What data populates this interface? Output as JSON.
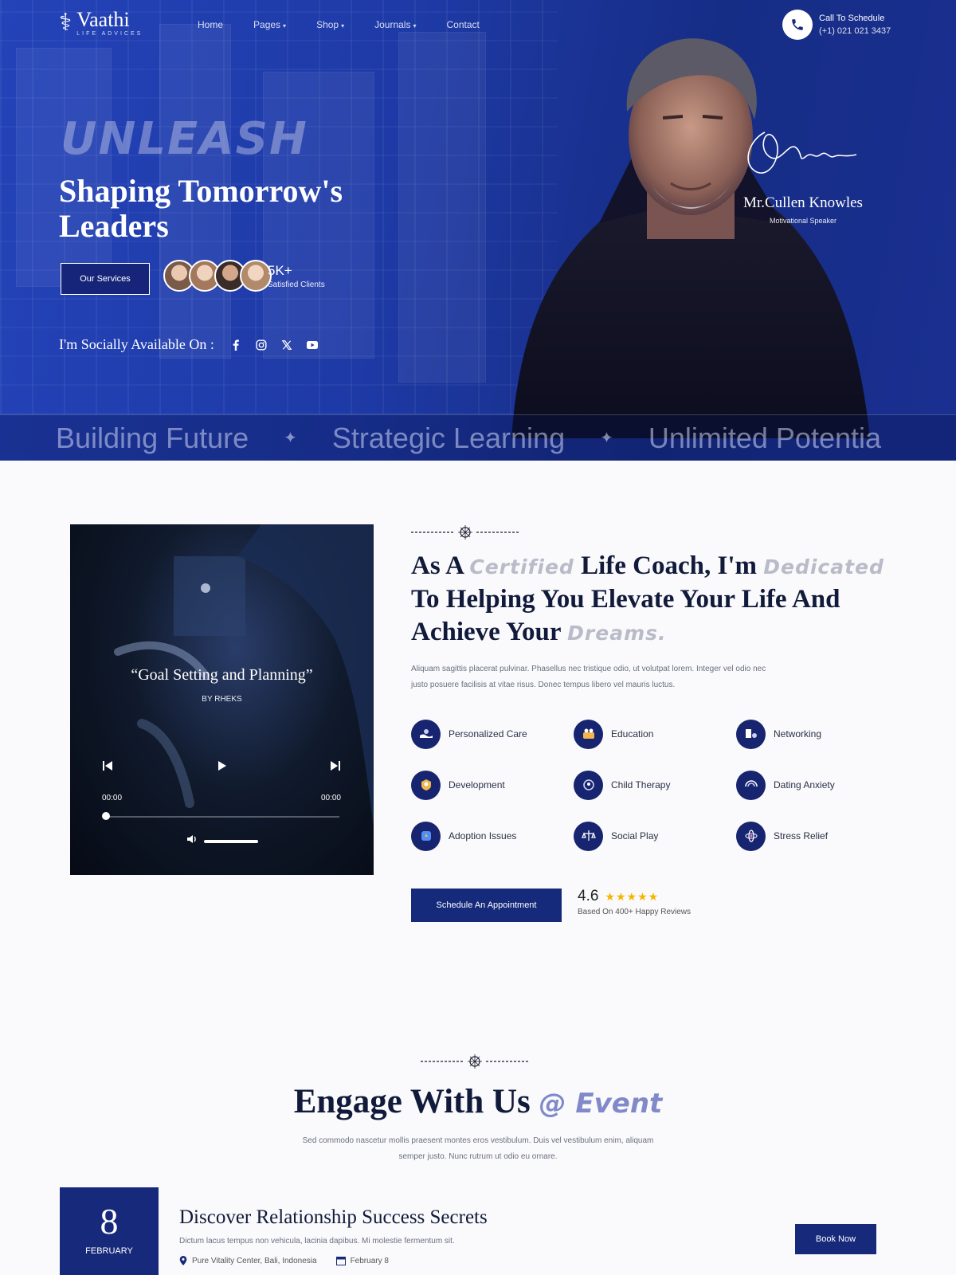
{
  "brand": {
    "name": "Vaathi",
    "tagline": "LIFE ADVICES"
  },
  "nav": [
    {
      "label": "Home",
      "dropdown": false
    },
    {
      "label": "Pages",
      "dropdown": true
    },
    {
      "label": "Shop",
      "dropdown": true
    },
    {
      "label": "Journals",
      "dropdown": true
    },
    {
      "label": "Contact",
      "dropdown": false
    }
  ],
  "call": {
    "title": "Call To Schedule",
    "phone": "(+1) 021 021 3437"
  },
  "hero": {
    "overlay_word": "UNLEASH",
    "headline": "Shaping Tomorrow's Leaders",
    "button": "Our Services",
    "clients_count": "5K+",
    "clients_label": "Satisfied Clients",
    "social_label": "I'm Socially Available On :",
    "social_icons": [
      "facebook-icon",
      "instagram-icon",
      "x-icon",
      "youtube-icon"
    ],
    "speaker_name": "Mr.Cullen Knowles",
    "speaker_role": "Motivational Speaker"
  },
  "ticker": [
    "Building Future",
    "Strategic Learning",
    "Unlimited Potentia"
  ],
  "player": {
    "quote": "“Goal Setting and Planning”",
    "by": "BY RHEKS",
    "time_current": "00:00",
    "time_total": "00:00",
    "progress": 0,
    "volume": 1.0
  },
  "about": {
    "heading_parts": [
      {
        "text": "As A ",
        "accent": false
      },
      {
        "text": "Certified",
        "accent": true
      },
      {
        "text": " Life Coach, I'm ",
        "accent": false
      },
      {
        "text": "Dedicated",
        "accent": true
      },
      {
        "text": " To Helping You Elevate Your Life And Achieve Your ",
        "accent": false
      },
      {
        "text": "Dreams.",
        "accent": true
      }
    ],
    "paragraph": "Aliquam sagittis placerat pulvinar. Phasellus nec tristique odio, ut volutpat lorem. Integer vel odio nec justo posuere facilisis at vitae risus. Donec tempus libero vel mauris luctus.",
    "services": [
      "Personalized Care",
      "Education",
      "Networking",
      "Development",
      "Child Therapy",
      "Dating Anxiety",
      "Adoption Issues",
      "Social Play",
      "Stress Relief"
    ],
    "button": "Schedule An Appointment",
    "rating": "4.6",
    "stars": 5,
    "reviews": "Based On 400+ Happy Reviews"
  },
  "events": {
    "heading": "Engage With Us",
    "heading_accent": "@ Event",
    "paragraph": "Sed commodo nascetur mollis praesent montes eros vestibulum. Duis vel vestibulum enim, aliquam semper justo. Nunc rutrum ut odio eu ornare.",
    "item": {
      "day": "8",
      "month": "FEBRUARY",
      "title": "Discover Relationship Success Secrets",
      "desc": "Dictum lacus tempus non vehicula, lacinia dapibus. Mi molestie fermentum sit.",
      "location": "Pure Vitality Center, Bali, Indonesia",
      "date": "February 8",
      "button": "Book Now"
    }
  },
  "colors": {
    "primary": "#16297a",
    "hero_blue": "#1e3aa6",
    "star": "#f5b500",
    "accent_light": "#b9bcc8"
  }
}
